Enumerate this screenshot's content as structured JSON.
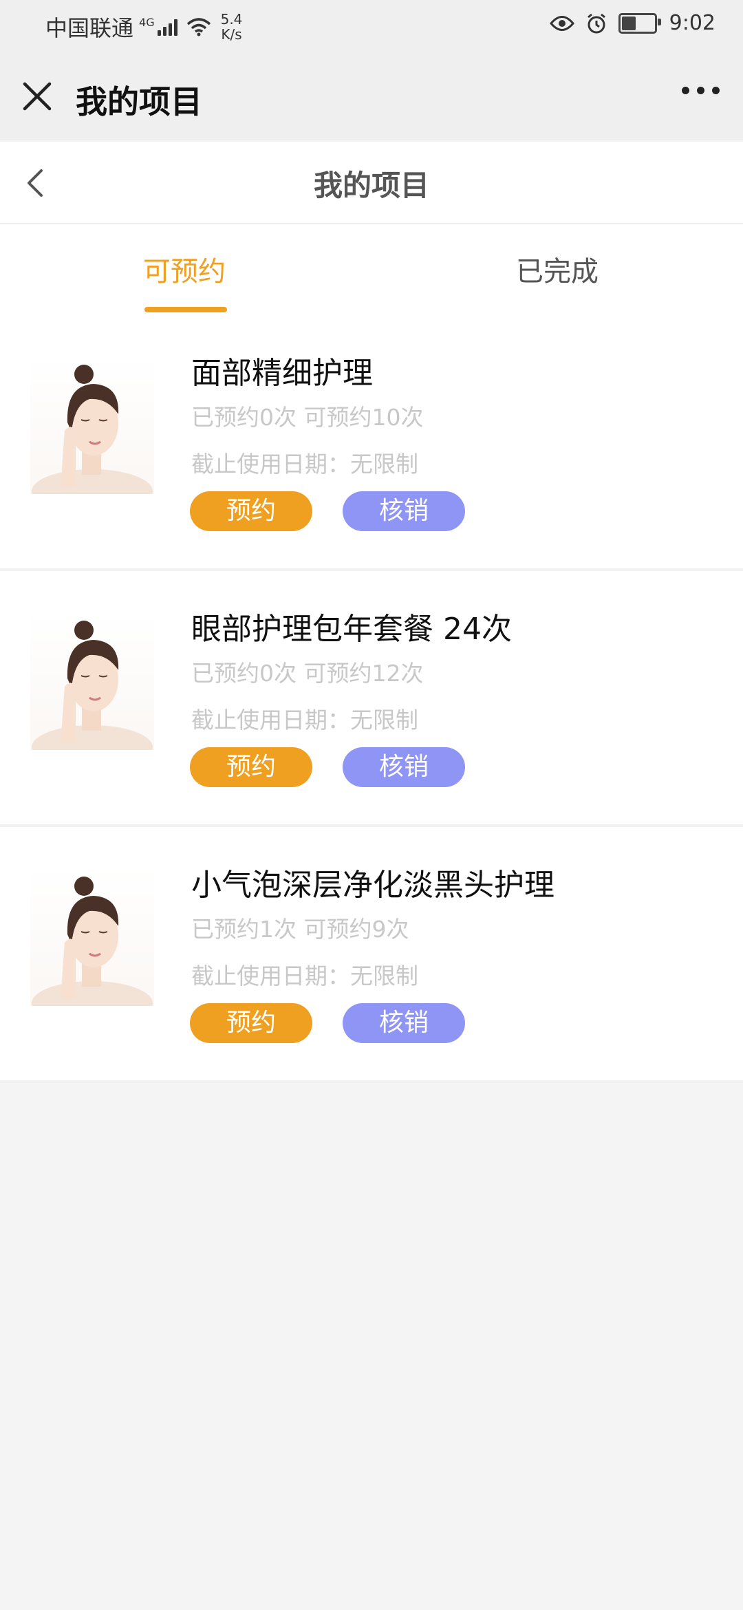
{
  "status_bar": {
    "carrier": "中国联通",
    "network_type": "4G",
    "speed_value": "5.4",
    "speed_unit": "K/s",
    "time": "9:02",
    "battery_level": 0.4
  },
  "wechat_bar": {
    "title": "我的项目"
  },
  "header": {
    "title": "我的项目"
  },
  "tabs": [
    {
      "label": "可预约",
      "active": true
    },
    {
      "label": "已完成",
      "active": false
    }
  ],
  "items": [
    {
      "title": "面部精细护理",
      "count_text": "已预约0次 可预约10次",
      "date_text": "截止使用日期：无限制",
      "book_label": "预约",
      "verify_label": "核销"
    },
    {
      "title": "眼部护理包年套餐 24次",
      "count_text": "已预约0次 可预约12次",
      "date_text": "截止使用日期：无限制",
      "book_label": "预约",
      "verify_label": "核销"
    },
    {
      "title": "小气泡深层净化淡黑头护理",
      "count_text": "已预约1次 可预约9次",
      "date_text": "截止使用日期：无限制",
      "book_label": "预约",
      "verify_label": "核销"
    }
  ],
  "colors": {
    "accent": "#f0a021",
    "verify": "#8f95f5",
    "background": "#f4f4f5"
  }
}
